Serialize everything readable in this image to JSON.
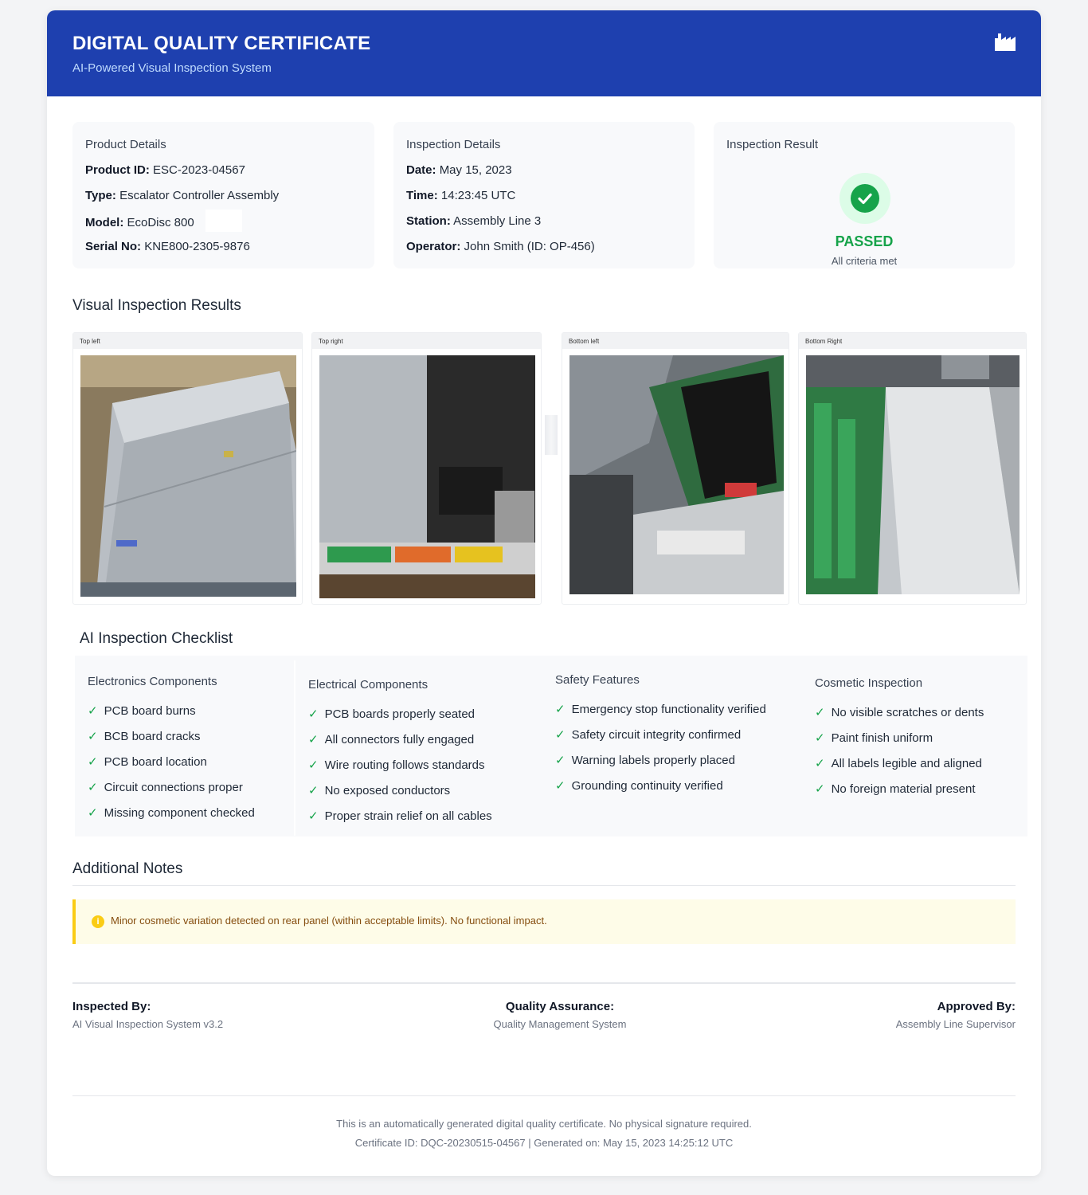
{
  "header": {
    "title": "DIGITAL QUALITY CERTIFICATE",
    "subtitle": "AI-Powered Visual Inspection System",
    "icon": "factory-icon"
  },
  "product": {
    "title": "Product Details",
    "rows": [
      {
        "label": "Product ID:",
        "value": "ESC-2023-04567"
      },
      {
        "label": "Type:",
        "value": "Escalator Controller Assembly"
      },
      {
        "label": "Model:",
        "value": "EcoDisc 800"
      },
      {
        "label": "Serial No:",
        "value": "KNE800-2305-9876"
      }
    ]
  },
  "inspection": {
    "title": "Inspection Details",
    "rows": [
      {
        "label": "Date:",
        "value": "May 15, 2023"
      },
      {
        "label": "Time:",
        "value": "14:23:45 UTC"
      },
      {
        "label": "Station:",
        "value": "Assembly Line 3"
      },
      {
        "label": "Operator:",
        "value": "John Smith (ID: OP-456)"
      }
    ]
  },
  "result": {
    "title": "Inspection Result",
    "status": "PASSED",
    "subtitle": "All criteria met",
    "color": "#16a34a"
  },
  "visual": {
    "title": "Visual Inspection Results",
    "photos": [
      {
        "label": "Top left"
      },
      {
        "label": "Top right"
      },
      {
        "label": "Bottom left"
      },
      {
        "label": "Bottom Right"
      }
    ]
  },
  "checklist": {
    "title": "AI Inspection Checklist",
    "check_glyph": "✓",
    "columns": [
      {
        "title": "Electronics Components",
        "items": [
          "PCB board burns",
          "BCB board cracks",
          "PCB board location",
          "Circuit connections proper",
          "Missing component checked"
        ]
      },
      {
        "title": "Electrical Components",
        "items": [
          "PCB boards properly seated",
          "All connectors fully engaged",
          "Wire routing follows standards",
          "No exposed conductors",
          "Proper strain relief on all cables"
        ]
      },
      {
        "title": "Safety Features",
        "items": [
          "Emergency stop functionality verified",
          "Safety circuit integrity confirmed",
          "Warning labels properly placed",
          "Grounding continuity verified"
        ]
      },
      {
        "title": "Cosmetic Inspection",
        "items": [
          "No visible scratches or dents",
          "Paint finish uniform",
          "All labels legible and aligned",
          "No foreign material present"
        ]
      }
    ]
  },
  "notes": {
    "title": "Additional Notes",
    "icon_glyph": "i",
    "text": "Minor cosmetic variation detected on rear panel (within acceptable limits). No functional impact."
  },
  "signatures": [
    {
      "label": "Inspected By:",
      "value": "AI Visual Inspection System v3.2"
    },
    {
      "label": "Quality Assurance:",
      "value": "Quality Management System"
    },
    {
      "label": "Approved By:",
      "value": "Assembly Line Supervisor"
    }
  ],
  "footer": {
    "line1": "This is an automatically generated digital quality certificate. No physical signature required.",
    "line2": "Certificate ID: DQC-20230515-04567 | Generated on: May 15, 2023 14:25:12 UTC"
  },
  "colors": {
    "header_bg": "#1e40af",
    "pass_green": "#16a34a",
    "note_accent": "#facc15"
  }
}
